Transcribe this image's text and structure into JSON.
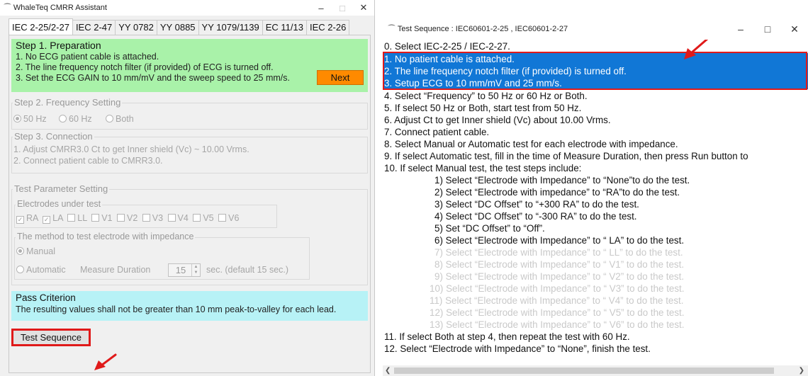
{
  "left": {
    "title": "WhaleTeq CMRR Assistant",
    "tabs": [
      "IEC 2-25/2-27",
      "IEC 2-47",
      "YY 0782",
      "YY 0885",
      "YY 1079/1139",
      "EC 11/13",
      "IEC 2-26"
    ],
    "step1": {
      "title": "Step 1. Preparation",
      "lines": [
        "1. No ECG patient cable is attached.",
        "2. The line frequency notch filter (if provided) of ECG is turned off.",
        "3. Set the ECG GAIN to 10 mm/mV and the sweep speed to 25 mm/s."
      ],
      "next_label": "Next"
    },
    "step2": {
      "title": "Step 2. Frequency Setting",
      "options": [
        "50 Hz",
        "60 Hz",
        "Both"
      ]
    },
    "step3": {
      "title": "Step 3. Connection",
      "lines": [
        "1. Adjust CMRR3.0 Ct to get Inner shield (Vc) ~ 10.00 Vrms.",
        "2. Connect patient cable to CMRR3.0."
      ]
    },
    "params": {
      "title": "Test Parameter Setting",
      "electrodes_title": "Electrodes under test",
      "electrodes": [
        "RA",
        "LA",
        "LL",
        "V1",
        "V2",
        "V3",
        "V4",
        "V5",
        "V6"
      ],
      "method_title": "The method to test electrode with impedance",
      "manual_label": "Manual",
      "automatic_label": "Automatic",
      "measure_label": "Measure Duration",
      "duration_value": "15",
      "duration_note": "sec. (default 15 sec.)"
    },
    "pass": {
      "title": "Pass Criterion",
      "text": "The resulting values shall not be greater than 10 mm peak-to-valley for each lead."
    },
    "test_sequence_label": "Test Sequence"
  },
  "right": {
    "title": "Test Sequence : IEC60601-2-25 , IEC60601-2-27",
    "lines": [
      "0. Select IEC-2-25 / IEC-2-27.",
      "1. No patient cable is attached.",
      "2. The line frequency notch filter (if provided) is turned off.",
      "3. Setup ECG to 10 mm/mV and 25 mm/s.",
      "4. Select “Frequency” to 50 Hz or 60 Hz or Both.",
      "5. If select 50 Hz or Both, start test from 50 Hz.",
      "6. Adjust Ct to get Inner shield (Vc) about 10.00 Vrms.",
      "7. Connect patient cable.",
      "8. Select Manual or Automatic test for each electrode with impedance.",
      "9. If select Automatic test, fill in the time of Measure Duration, then press Run button to",
      "10. If select Manual test, the test steps include:"
    ],
    "sub_lines": [
      "1) Select  “Electrode with Impedance” to “None”to do the test.",
      "2) Select “Electrode with impedance” to “RA”to do the test.",
      "3) Select “DC Offset” to “+300 RA” to do the test.",
      "4) Select “DC Offset” to  “-300 RA” to do the test.",
      "5) Set “DC Offset” to “Off”.",
      "6) Select “Electrode with Impedance” to “ LA” to do the test.",
      "7) Select “Electrode with Impedance” to “ LL” to do the test.",
      "8) Select “Electrode with Impedance” to “ V1” to do the test.",
      "9) Select “Electrode with Impedance” to “ V2” to do the test.",
      "10) Select “Electrode with Impedance” to “ V3” to do the test.",
      "11) Select “Electrode with Impedance” to “ V4” to do the test.",
      "12) Select “Electrode with Impedance” to “ V5” to do the test.",
      "13) Select “Electrode with Impedance” to “ V6” to do the test."
    ],
    "end_lines": [
      "11. If select Both at step 4, then repeat the test with 60 Hz.",
      "12. Select “Electrode with Impedance” to “None”, finish the test."
    ]
  },
  "colors": {
    "step1_bg": "#a9f2a9",
    "pass_bg": "#b7f2f6",
    "next_button": "#ff8a00",
    "highlight": "#1177d6",
    "annotation_red": "#e01a1a"
  },
  "icons": [
    "whale-icon",
    "minimize-icon",
    "maximize-icon",
    "close-icon",
    "arrow-annotation-icon",
    "spinner-arrows-icon",
    "scroll-left-icon",
    "scroll-right-icon"
  ]
}
